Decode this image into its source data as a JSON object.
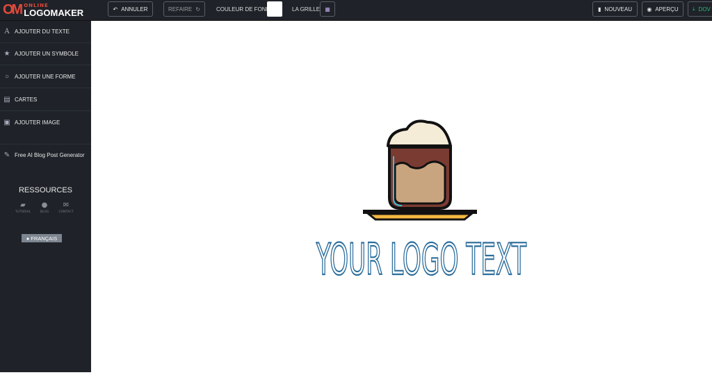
{
  "brand": {
    "mark": "OM",
    "small": "ONLINE",
    "name": "LOGOMAKER"
  },
  "toolbar": {
    "undo": "ANNULER",
    "redo": "REFAIRE",
    "bg_color_label": "COULEUR DE FOND",
    "bg_color": "#ffffff",
    "grid_label": "LA GRILLE",
    "new": "NOUVEAU",
    "preview": "APERÇU",
    "download": "DOV"
  },
  "sidebar": {
    "items": [
      {
        "label": "AJOUTER DU TEXTE",
        "icon": "text-icon"
      },
      {
        "label": "AJOUTER UN SYMBOLE",
        "icon": "star-icon"
      },
      {
        "label": "AJOUTER UNE FORME",
        "icon": "circle-icon"
      },
      {
        "label": "CARTES",
        "icon": "card-icon"
      },
      {
        "label": "AJOUTER IMAGE",
        "icon": "image-icon"
      },
      {
        "label": "Free AI Blog Post Generator",
        "icon": "pencil-icon"
      }
    ],
    "resources_title": "RESSOURCES",
    "resources": [
      {
        "label": "TUTORIAL",
        "icon": "book-icon"
      },
      {
        "label": "BLOG",
        "icon": "chat-icon"
      },
      {
        "label": "CONTACT",
        "icon": "envelope-icon"
      }
    ],
    "language": "FRANÇAIS"
  },
  "canvas": {
    "logo_text": "YOUR LOGO TEXT",
    "text_color": "#2b6d9b"
  },
  "colors": {
    "brand": "#e0493a",
    "panel": "#1f2329",
    "download": "#2bb673"
  }
}
